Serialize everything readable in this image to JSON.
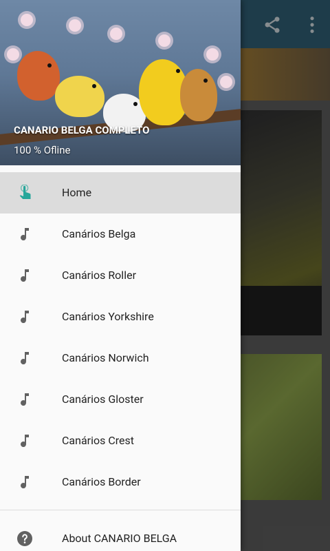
{
  "colors": {
    "appbar": "#2f5d72",
    "drawer_bg": "#fafafa",
    "active_row": "#dcdcdc",
    "home_icon": "#26a69a",
    "menu_icon": "#616161"
  },
  "appbar": {
    "share_icon": "share-icon",
    "overflow_icon": "more-vert-icon"
  },
  "drawer": {
    "title": "CANARIO BELGA COMPLETO",
    "subtitle": "100 % Ofline",
    "items": [
      {
        "label": "Home",
        "icon": "touch-icon",
        "active": true
      },
      {
        "label": "Canários Belga",
        "icon": "music-note-icon",
        "active": false
      },
      {
        "label": "Canários Roller",
        "icon": "music-note-icon",
        "active": false
      },
      {
        "label": "Canários Yorkshire",
        "icon": "music-note-icon",
        "active": false
      },
      {
        "label": "Canários Norwich",
        "icon": "music-note-icon",
        "active": false
      },
      {
        "label": "Canários Gloster",
        "icon": "music-note-icon",
        "active": false
      },
      {
        "label": "Canários Crest",
        "icon": "music-note-icon",
        "active": false
      },
      {
        "label": "Canários Border",
        "icon": "music-note-icon",
        "active": false
      }
    ],
    "about": {
      "label": "About CANARIO BELGA",
      "icon": "help-icon"
    }
  }
}
